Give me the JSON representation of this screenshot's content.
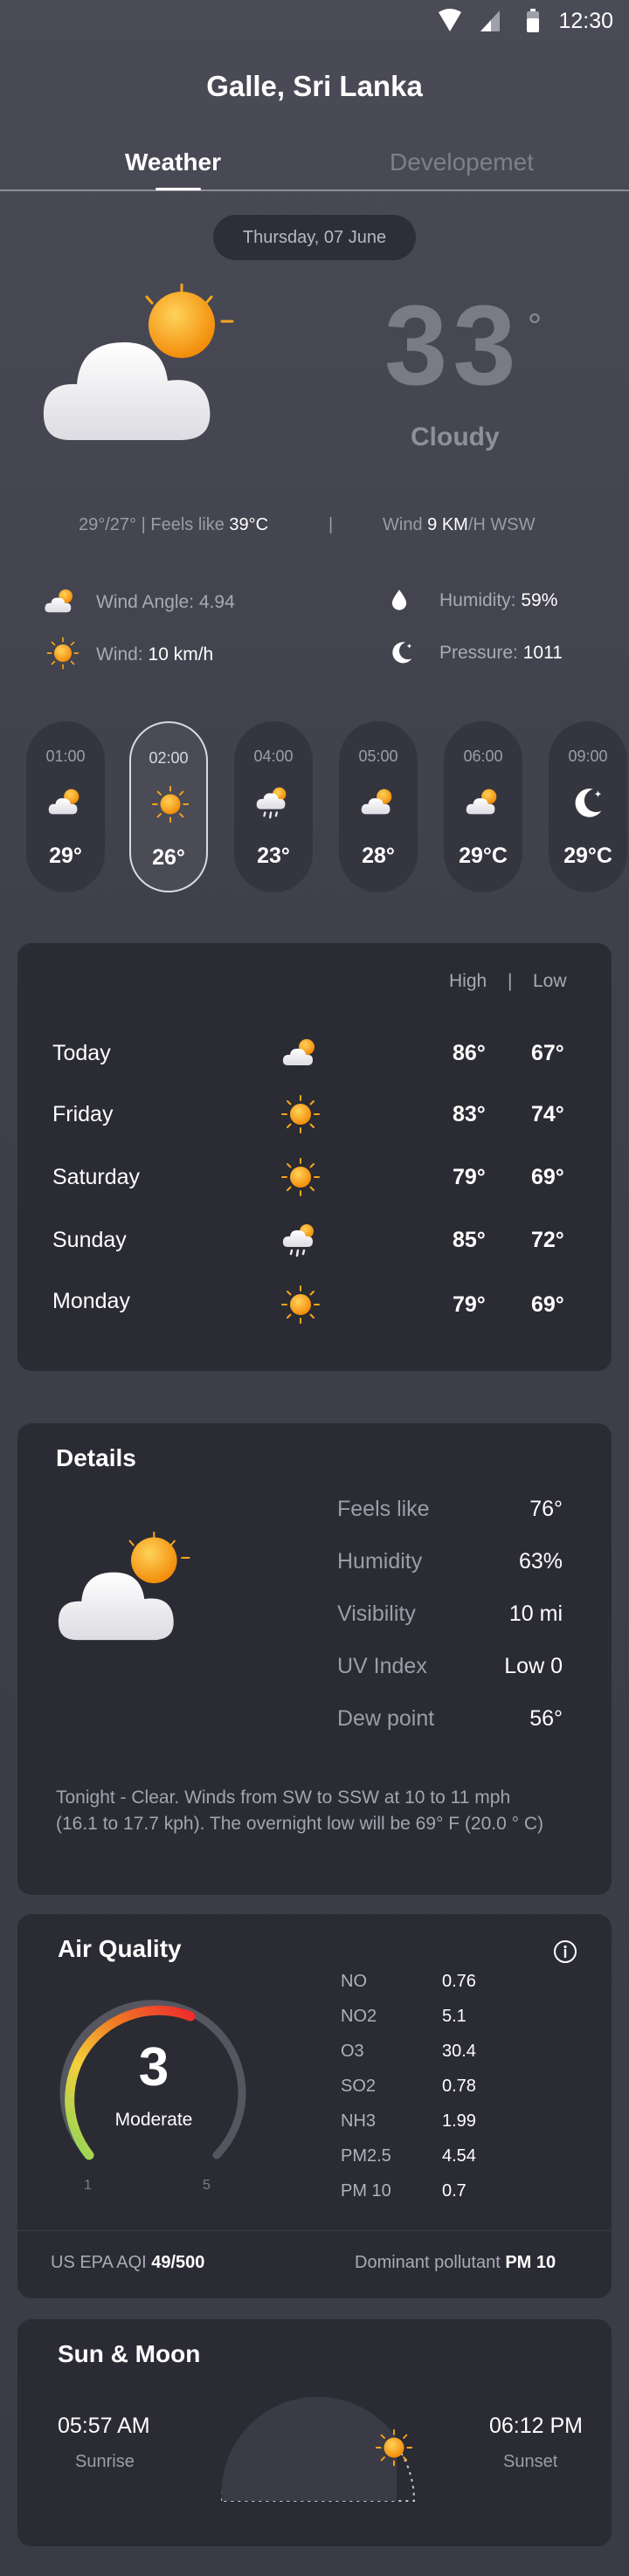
{
  "status_bar": {
    "time": "12:30"
  },
  "location": "Galle, Sri Lanka",
  "tabs": [
    {
      "label": "Weather",
      "active": true
    },
    {
      "label": "Developemet",
      "active": false
    }
  ],
  "date": "Thursday, 07 June",
  "current": {
    "temp": "33",
    "degree_symbol": "°",
    "condition": "Cloudy",
    "range": "29°/27° | Feels like",
    "feels_like": "39°C",
    "separator": "|",
    "wind_label": "Wind",
    "wind_value": "9 KM",
    "wind_dir": "/H WSW"
  },
  "stats": {
    "wind_angle_label": "Wind Angle:",
    "wind_angle_value": "4.94",
    "wind_label": "Wind:",
    "wind_value": "10 km/h",
    "humidity_label": "Humidity:",
    "humidity_value": "59%",
    "pressure_label": "Pressure:",
    "pressure_value": "1011"
  },
  "hourly": [
    {
      "time": "01:00",
      "icon": "partly-cloudy-icon",
      "temp": "29°",
      "active": false
    },
    {
      "time": "02:00",
      "icon": "sun-icon",
      "temp": "26°",
      "active": true
    },
    {
      "time": "04:00",
      "icon": "rain-cloud-icon",
      "temp": "23°",
      "active": false
    },
    {
      "time": "05:00",
      "icon": "partly-cloudy-icon",
      "temp": "28°",
      "active": false
    },
    {
      "time": "06:00",
      "icon": "partly-cloudy-icon",
      "temp": "29°C",
      "active": false
    },
    {
      "time": "09:00",
      "icon": "moon-icon",
      "temp": "29°C",
      "active": false
    }
  ],
  "weekly": {
    "high_label": "High",
    "separator": "|",
    "low_label": "Low",
    "days": [
      {
        "day": "Today",
        "icon": "partly-cloudy-icon",
        "high": "86°",
        "low": "67°"
      },
      {
        "day": "Friday",
        "icon": "sun-icon",
        "high": "83°",
        "low": "74°"
      },
      {
        "day": "Saturday",
        "icon": "sun-icon",
        "high": "79°",
        "low": "69°"
      },
      {
        "day": "Sunday",
        "icon": "rain-cloud-icon",
        "high": "85°",
        "low": "72°"
      },
      {
        "day": "Monday",
        "icon": "sun-icon",
        "high": "79°",
        "low": "69°"
      }
    ]
  },
  "details": {
    "title": "Details",
    "rows": [
      {
        "label": "Feels like",
        "value": "76°"
      },
      {
        "label": "Humidity",
        "value": "63%"
      },
      {
        "label": "Visibility",
        "value": "10 mi"
      },
      {
        "label": "UV Index",
        "value": "Low 0"
      },
      {
        "label": "Dew point",
        "value": "56°"
      }
    ],
    "description_line1": "Tonight - Clear. Winds from SW to SSW at 10 to 11 mph",
    "description_line2": "(16.1 to 17.7 kph). The overnight low will be 69° F (20.0 ° C)"
  },
  "air_quality": {
    "title": "Air Quality",
    "index": "3",
    "index_value": 3,
    "scale_min": "1",
    "scale_max": "5",
    "level": "Moderate",
    "pollutants": [
      {
        "name": "NO",
        "value": "0.76"
      },
      {
        "name": "NO2",
        "value": "5.1"
      },
      {
        "name": "O3",
        "value": "30.4"
      },
      {
        "name": "SO2",
        "value": "0.78"
      },
      {
        "name": "NH3",
        "value": "1.99"
      },
      {
        "name": "PM2.5",
        "value": "4.54"
      },
      {
        "name": "PM 10",
        "value": "0.7"
      }
    ],
    "epa_label": "US EPA AQI",
    "epa_value": "49/500",
    "dominant_label": "Dominant pollutant",
    "dominant_value": "PM 10"
  },
  "sun_moon": {
    "title": "Sun & Moon",
    "sunrise_time": "05:57 AM",
    "sunrise_label": "Sunrise",
    "sunset_time": "06:12 PM",
    "sunset_label": "Sunset",
    "day_progress": 0.78
  },
  "colors": {
    "sun": "#f7a51c",
    "cloud": "#f2f2f4",
    "card": "#2a2b33",
    "gauge_red": "#ee2b2b",
    "gauge_green": "#8bd65a"
  }
}
